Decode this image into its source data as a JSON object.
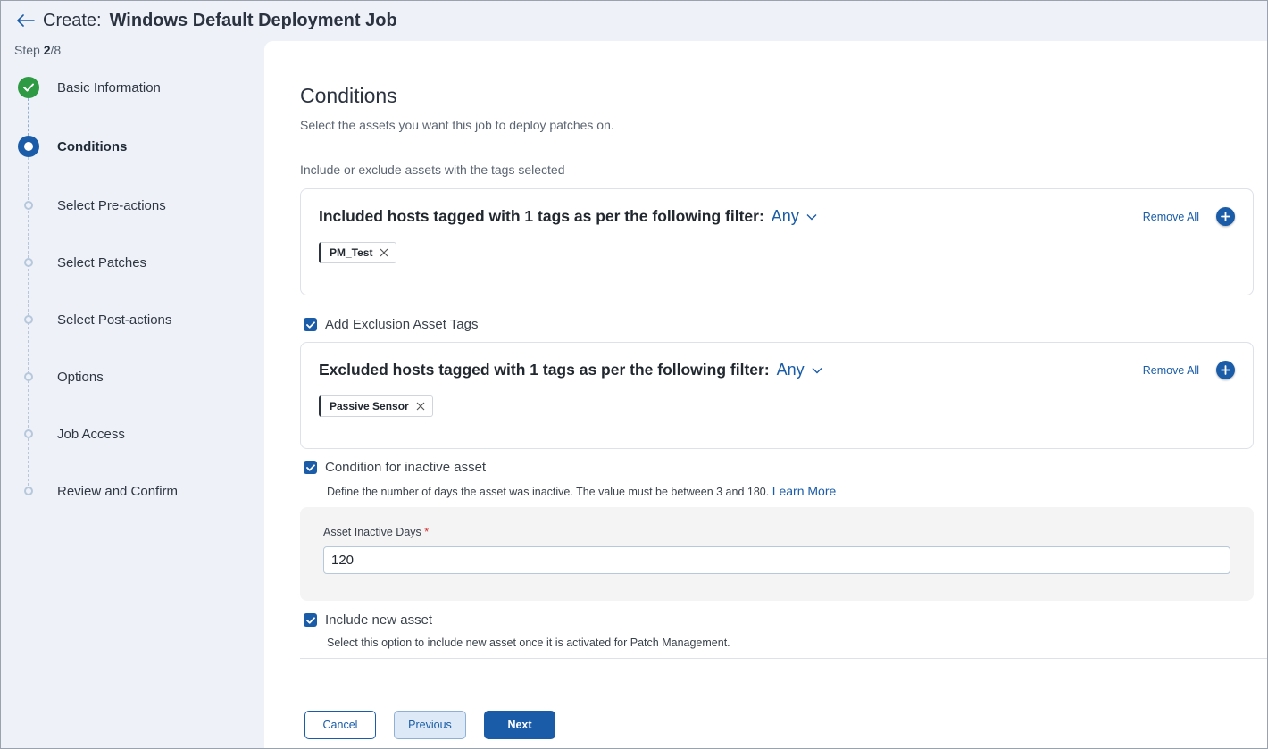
{
  "header": {
    "prefix": "Create:",
    "title": "Windows Default Deployment Job"
  },
  "stepper": {
    "step_label": "Step",
    "current": "2",
    "total": "/8",
    "steps": [
      {
        "label": "Basic Information",
        "state": "done"
      },
      {
        "label": "Conditions",
        "state": "active"
      },
      {
        "label": "Select Pre-actions",
        "state": "pending"
      },
      {
        "label": "Select Patches",
        "state": "pending"
      },
      {
        "label": "Select Post-actions",
        "state": "pending"
      },
      {
        "label": "Options",
        "state": "pending"
      },
      {
        "label": "Job Access",
        "state": "pending"
      },
      {
        "label": "Review and Confirm",
        "state": "pending"
      }
    ]
  },
  "main": {
    "title": "Conditions",
    "subtitle": "Select the assets you want this job to deploy patches on.",
    "include_label": "Include or exclude assets with the tags selected",
    "included": {
      "title": "Included hosts tagged with 1 tags as per the following filter:",
      "filter": "Any",
      "remove_all": "Remove All",
      "tags": [
        "PM_Test"
      ]
    },
    "exclusion_checkbox": {
      "label": "Add Exclusion Asset Tags",
      "checked": true
    },
    "excluded": {
      "title": "Excluded hosts tagged with 1 tags as per the following filter:",
      "filter": "Any",
      "remove_all": "Remove All",
      "tags": [
        "Passive Sensor"
      ]
    },
    "inactive_checkbox": {
      "label": "Condition for inactive asset",
      "checked": true
    },
    "inactive_help": "Define the number of days the asset was inactive. The value must be between 3 and 180.",
    "learn_more": "Learn More",
    "inactive_field": {
      "label": "Asset Inactive Days",
      "required_mark": "*",
      "value": "120"
    },
    "new_asset_checkbox": {
      "label": "Include new asset",
      "checked": true
    },
    "new_asset_help": "Select this option to include new asset once it is activated for Patch Management."
  },
  "footer": {
    "cancel": "Cancel",
    "previous": "Previous",
    "next": "Next"
  },
  "colors": {
    "accent": "#1a5ca8",
    "success": "#2e9a44",
    "required": "#d02f2f"
  }
}
